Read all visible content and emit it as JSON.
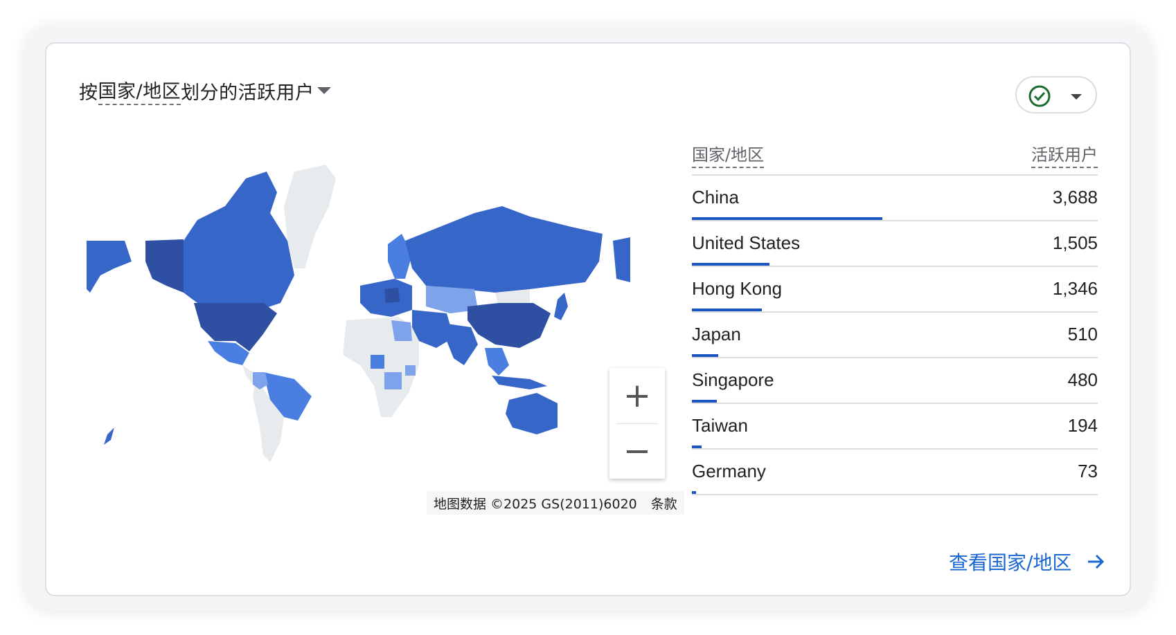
{
  "card": {
    "title_prefix": "按",
    "title_dimension": "国家/地区",
    "title_suffix": "划分的活跃用户"
  },
  "status": {
    "icon": "check-circle-icon",
    "color": "#1e7e34"
  },
  "table": {
    "col_country": "国家/地区",
    "col_users": "活跃用户",
    "max_value": 3688,
    "rows": [
      {
        "name": "China",
        "value": "3,688",
        "num": 3688
      },
      {
        "name": "United States",
        "value": "1,505",
        "num": 1505
      },
      {
        "name": "Hong Kong",
        "value": "1,346",
        "num": 1346
      },
      {
        "name": "Japan",
        "value": "510",
        "num": 510
      },
      {
        "name": "Singapore",
        "value": "480",
        "num": 480
      },
      {
        "name": "Taiwan",
        "value": "194",
        "num": 194
      },
      {
        "name": "Germany",
        "value": "73",
        "num": 73
      }
    ]
  },
  "map": {
    "attribution": "地图数据 ©2025 GS(2011)6020",
    "terms": "条款",
    "zoom_in": "+",
    "zoom_out": "−",
    "colors": {
      "darkest": "#2f4fa3",
      "dark": "#3566c8",
      "mid": "#4a7ee0",
      "light": "#7ea3ea",
      "none": "#e8ebee"
    }
  },
  "footer": {
    "view_link": "查看国家/地区"
  }
}
